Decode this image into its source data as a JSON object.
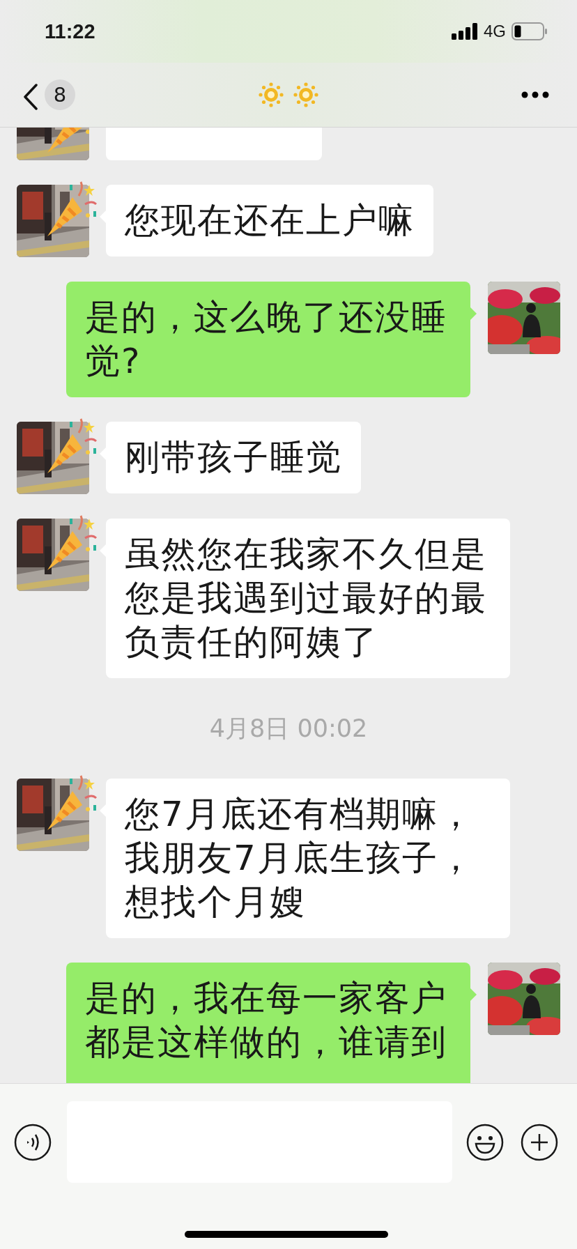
{
  "status_bar": {
    "time": "11:22",
    "network": "4G"
  },
  "nav": {
    "unread": "8"
  },
  "messages": [
    {
      "kind": "incoming-cut"
    },
    {
      "kind": "incoming",
      "text": "您现在还在上户嘛"
    },
    {
      "kind": "outgoing",
      "text": "是的，这么晚了还没睡觉?"
    },
    {
      "kind": "incoming",
      "text": "刚带孩子睡觉"
    },
    {
      "kind": "incoming",
      "text": "虽然您在我家不久但是您是我遇到过最好的最负责任的阿姨了"
    },
    {
      "kind": "time",
      "text": "4月8日 00:02"
    },
    {
      "kind": "incoming",
      "text": "您7月底还有档期嘛，我朋友7月底生孩子，想找个月嫂"
    },
    {
      "kind": "outgoing-cut",
      "text": "是的，我在每一家客户都是这样做的，谁请到"
    }
  ]
}
